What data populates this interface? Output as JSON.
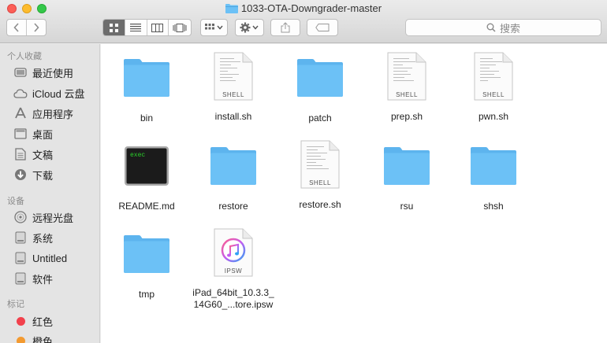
{
  "window": {
    "title": "1033-OTA-Downgrader-master"
  },
  "toolbar": {
    "back_icon": "chevron-left-icon",
    "forward_icon": "chevron-right-icon",
    "view_modes": [
      "icon-view",
      "list-view",
      "column-view",
      "cover-flow-view"
    ],
    "active_view": "icon-view",
    "search_placeholder": "搜索"
  },
  "sidebar": {
    "favorites_header": "个人收藏",
    "favorites": [
      {
        "label": "最近使用",
        "icon": "recents-icon"
      },
      {
        "label": "iCloud 云盘",
        "icon": "cloud-icon"
      },
      {
        "label": "应用程序",
        "icon": "applications-icon"
      },
      {
        "label": "桌面",
        "icon": "desktop-icon"
      },
      {
        "label": "文稿",
        "icon": "documents-icon"
      },
      {
        "label": "下载",
        "icon": "downloads-icon"
      }
    ],
    "devices_header": "设备",
    "devices": [
      {
        "label": "远程光盘",
        "icon": "disc-icon"
      },
      {
        "label": "系统",
        "icon": "disk-icon"
      },
      {
        "label": "Untitled",
        "icon": "disk-icon"
      },
      {
        "label": "软件",
        "icon": "disk-icon"
      }
    ],
    "tags_header": "标记",
    "tags": [
      {
        "label": "红色",
        "color": "#f2414c"
      },
      {
        "label": "橙色",
        "color": "#f39a30"
      }
    ]
  },
  "files": [
    {
      "name": "bin",
      "kind": "folder"
    },
    {
      "name": "install.sh",
      "kind": "shell",
      "badge": "SHELL"
    },
    {
      "name": "patch",
      "kind": "folder"
    },
    {
      "name": "prep.sh",
      "kind": "shell",
      "badge": "SHELL"
    },
    {
      "name": "pwn.sh",
      "kind": "shell",
      "badge": "SHELL"
    },
    {
      "name": "README.md",
      "kind": "exec",
      "badge": "exec"
    },
    {
      "name": "restore",
      "kind": "folder"
    },
    {
      "name": "restore.sh",
      "kind": "shell",
      "badge": "SHELL"
    },
    {
      "name": "rsu",
      "kind": "folder"
    },
    {
      "name": "shsh",
      "kind": "folder"
    },
    {
      "name": "tmp",
      "kind": "folder"
    },
    {
      "name": "iPad_64bit_10.3.3_\n14G60_...tore.ipsw",
      "name_line1": "iPad_64bit_10.3.3_",
      "name_line2": "14G60_...tore.ipsw",
      "kind": "ipsw",
      "badge": "IPSW"
    }
  ],
  "colors": {
    "folder_body": "#6cc1f6",
    "folder_tab": "#5db4ee",
    "tag_red": "#f2414c",
    "tag_orange": "#f39a30",
    "exec_text": "#2ad12a"
  }
}
